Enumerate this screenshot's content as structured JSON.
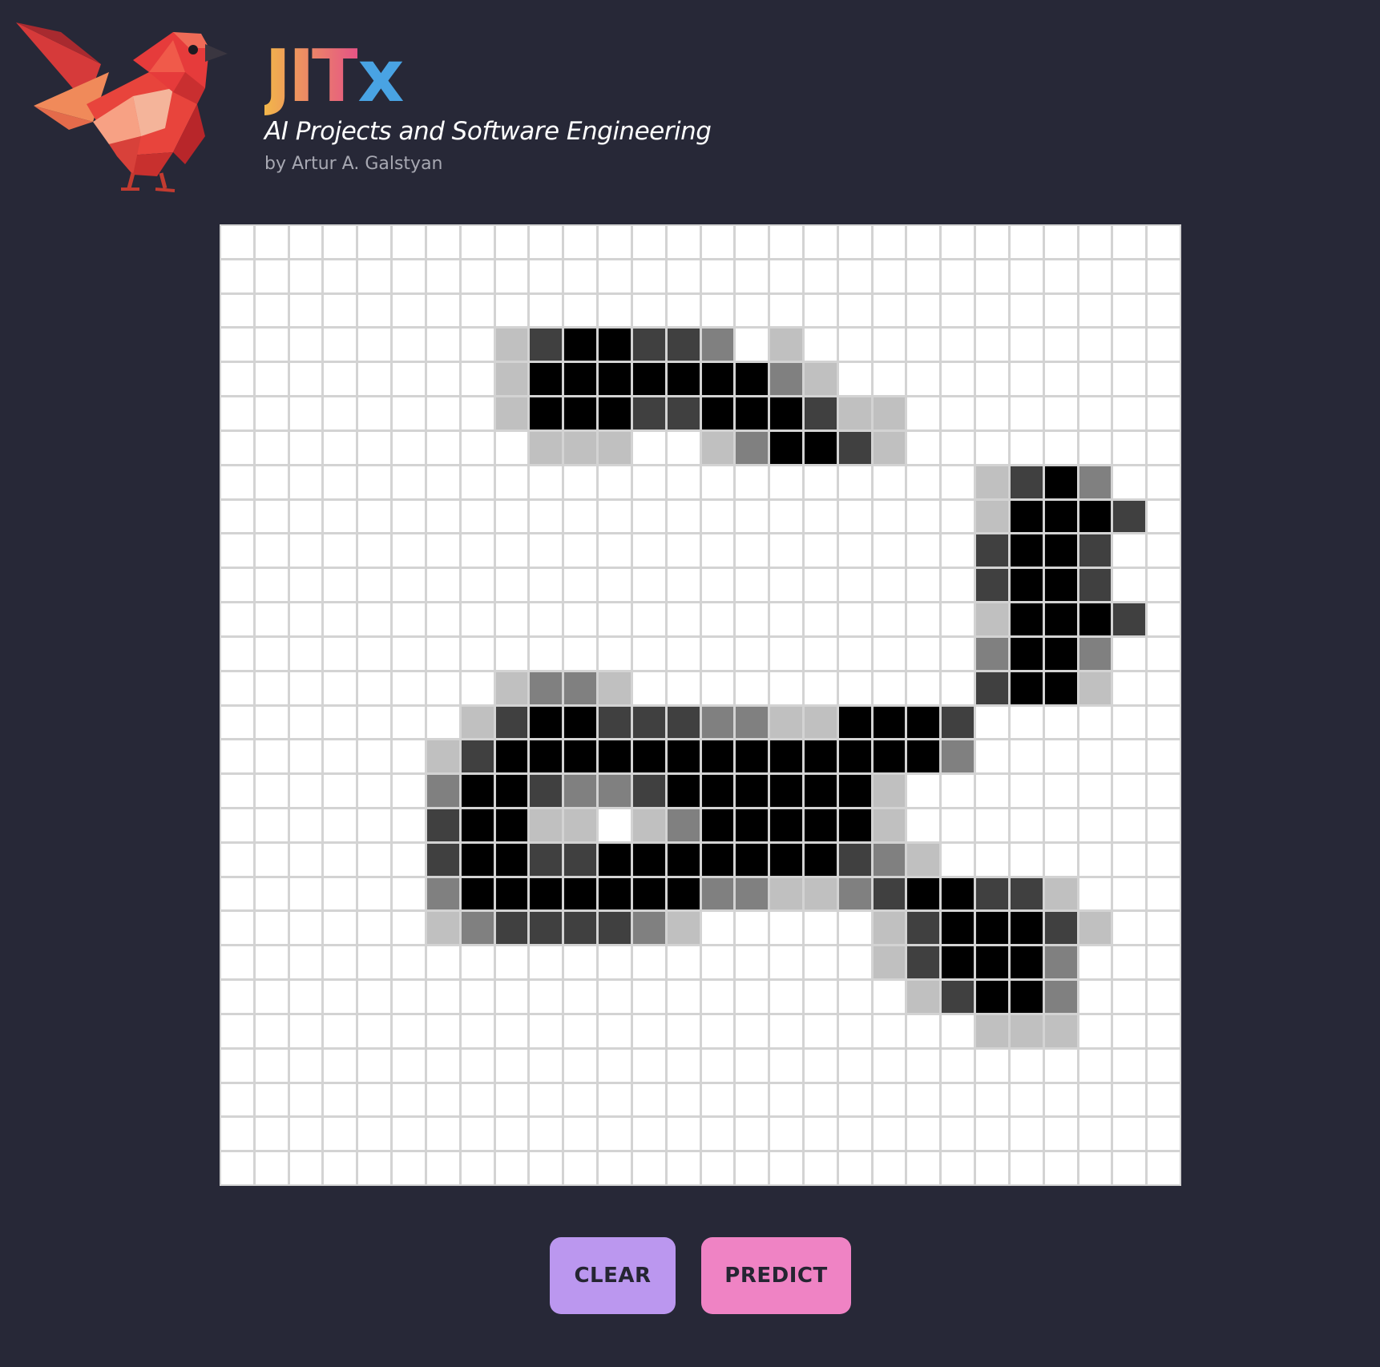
{
  "header": {
    "brand": {
      "part1": "JIT",
      "part2": "x"
    },
    "tagline": "AI Projects and Software Engineering",
    "byline": "by Artur A. Galstyan",
    "logo_icon": "low-poly-red-bird-icon"
  },
  "canvas": {
    "rows": 28,
    "cols": 28,
    "shade_colors": [
      "#ffffff",
      "#c0c0c0",
      "#808080",
      "#404040",
      "#000000"
    ],
    "pixels": [
      "............................",
      "............................",
      "............................",
      "........1344332.1...........",
      "........1444444421..........",
      "........144433444311........",
      ".........111..124431........",
      "......................1342..",
      "......................14443.",
      "......................3443..",
      "......................3443..",
      "......................14443.",
      "......................2442..",
      "........1221..........3441..",
      ".......134433322114443......",
      "......1344444444444442......",
      "......24432234444441........",
      "......34411.12444441........",
      "......344334444444321.......",
      "......2444444422112344331...",
      "......12333321.....1344431..",
      "...................134442...",
      "....................13442...",
      "......................111...",
      "............................",
      "............................",
      "............................",
      "............................"
    ]
  },
  "controls": {
    "clear_label": "CLEAR",
    "predict_label": "PREDICT"
  },
  "colors": {
    "background": "#272837",
    "brand_gradient_start": "#f2b64a",
    "brand_gradient_end": "#e55485",
    "brand_x": "#49a3e3",
    "clear_button": "#bb97ef",
    "predict_button": "#ef83c4"
  }
}
